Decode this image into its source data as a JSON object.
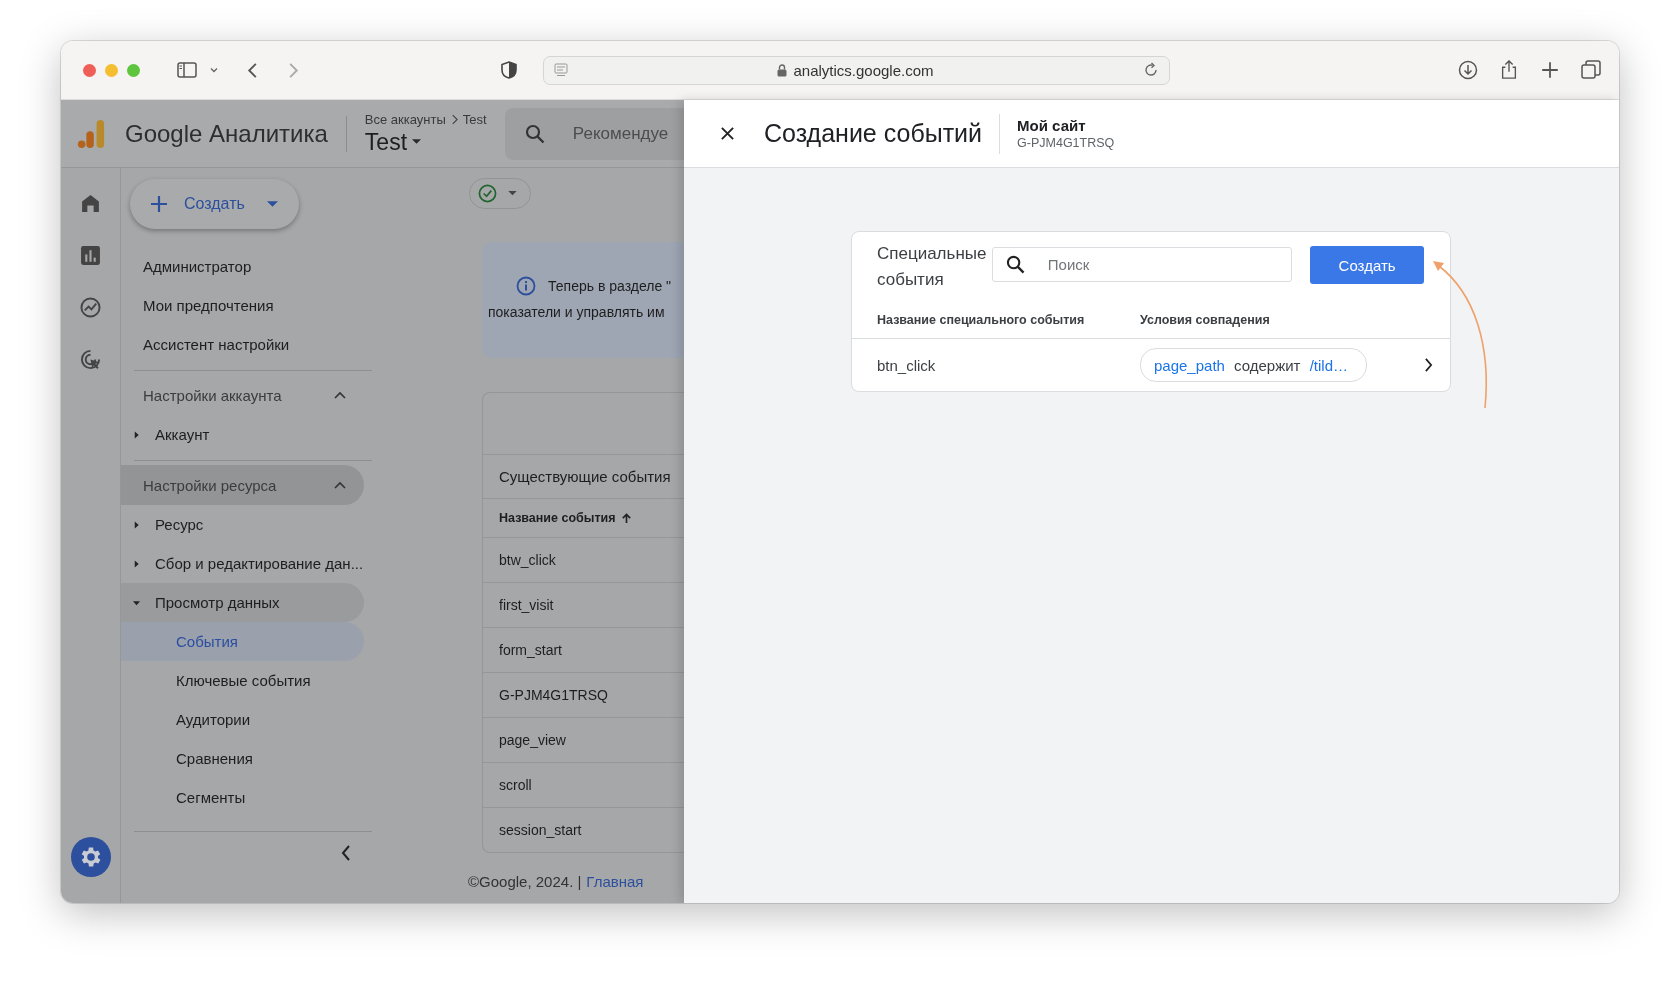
{
  "browser": {
    "address": "analytics.google.com"
  },
  "header": {
    "product": "Google Аналитика",
    "breadcrumb": [
      "Все аккаунты",
      "Test"
    ],
    "property": "Test",
    "search_placeholder": "Рекомендуе"
  },
  "create_button": "Создать",
  "nav": {
    "top_items": [
      "Администратор",
      "Мои предпочтения",
      "Ассистент настройки"
    ],
    "sections": [
      {
        "title": "Настройки аккаунта",
        "expanded": true,
        "highlighted": false,
        "items": [
          {
            "label": "Аккаунт",
            "expanded": false,
            "highlighted": false
          }
        ]
      },
      {
        "title": "Настройки ресурса",
        "expanded": true,
        "highlighted": true,
        "items": [
          {
            "label": "Ресурс",
            "expanded": false,
            "highlighted": false
          },
          {
            "label": "Сбор и редактирование дан...",
            "expanded": false,
            "highlighted": false
          },
          {
            "label": "Просмотр данных",
            "expanded": true,
            "highlighted": true,
            "children": [
              {
                "label": "События",
                "selected": true
              },
              {
                "label": "Ключевые события",
                "selected": false
              },
              {
                "label": "Аудитории",
                "selected": false
              },
              {
                "label": "Сравнения",
                "selected": false
              },
              {
                "label": "Сегменты",
                "selected": false
              }
            ]
          }
        ]
      }
    ]
  },
  "info": {
    "lines": [
      "Теперь в разделе \"",
      "показатели и управлять им"
    ]
  },
  "events_table": {
    "title": "Существующие события",
    "column": "Название события",
    "rows": [
      "btw_click",
      "first_visit",
      "form_start",
      "G-PJM4G1TRSQ",
      "page_view",
      "scroll",
      "session_start"
    ]
  },
  "footer": {
    "copyright": "©Google, 2024. |",
    "link": "Главная"
  },
  "panel": {
    "title": "Создание событий",
    "site_name": "Мой сайт",
    "site_id": "G-PJM4G1TRSQ",
    "card": {
      "title": "Специальные события",
      "search_placeholder": "Поиск",
      "create_button": "Создать",
      "columns": [
        "Название специального события",
        "Условия совпадения"
      ],
      "rows": [
        {
          "name": "btn_click",
          "condition": {
            "parameter": "page_path",
            "operator": "содержит",
            "value": "/tild…"
          }
        }
      ]
    }
  }
}
